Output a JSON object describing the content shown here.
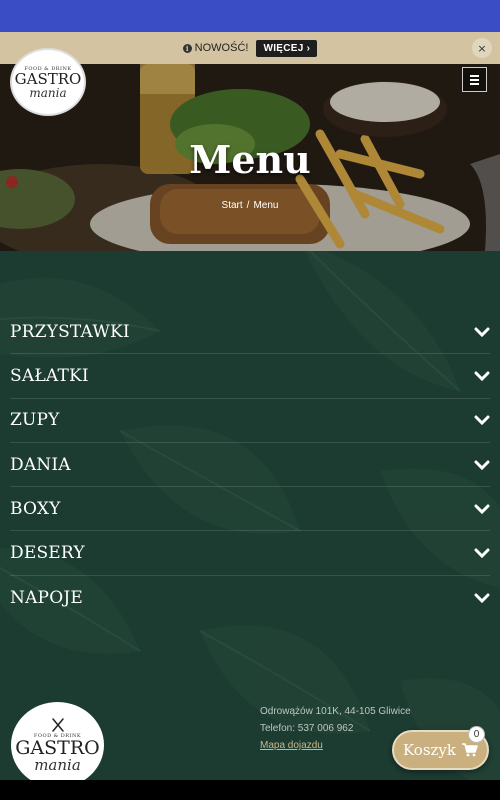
{
  "notice": {
    "text": "NOWOŚĆ!",
    "more_label": "WIĘCEJ ›",
    "close_label": "×"
  },
  "brand": {
    "small_text": "FOOD & DRINK",
    "name": "GASTRO",
    "script": "mania"
  },
  "hero": {
    "title": "Menu",
    "breadcrumb": [
      "Start",
      "/",
      "Menu"
    ]
  },
  "menu_categories": [
    {
      "label": "PRZYSTAWKI"
    },
    {
      "label": "SAŁATKI"
    },
    {
      "label": "ZUPY"
    },
    {
      "label": "DANIA"
    },
    {
      "label": "BOXY"
    },
    {
      "label": "DESERY"
    },
    {
      "label": "NAPOJE"
    }
  ],
  "footer": {
    "address": "Odrowążów 101K, 44-105 Gliwice",
    "phone": "Telefon: 537 006 962",
    "map_link": "Mapa dojazdu"
  },
  "cart": {
    "label": "Koszyk",
    "count": "0"
  },
  "colors": {
    "statusbar": "#3b4dc4",
    "notice_bg": "#d3c3a0",
    "main_bg": "#1c3b31",
    "cart_bg": "#c9b07e"
  }
}
